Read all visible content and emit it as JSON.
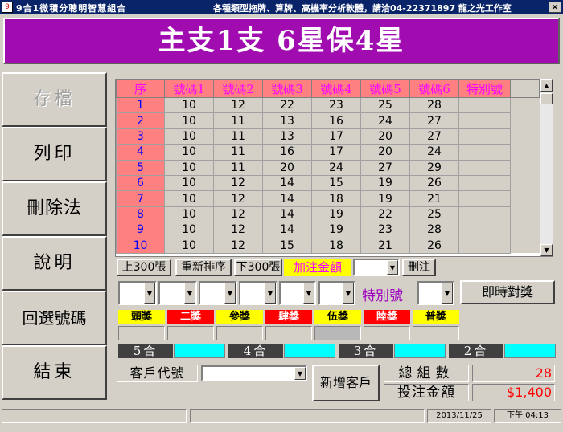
{
  "window": {
    "title": "9合1微積分聰明智慧組合",
    "subtitle": "各種類型拖牌、算牌、高機率分析軟體，請洽04-22371897 龍之光工作室",
    "close_glyph": "×"
  },
  "banner": {
    "text": "主支1支   6星保4星"
  },
  "sidebar": {
    "items": [
      {
        "label": "存檔",
        "enabled": false
      },
      {
        "label": "列印",
        "enabled": true
      },
      {
        "label": "刪除法",
        "enabled": true
      },
      {
        "label": "說明",
        "enabled": true
      },
      {
        "label": "回選號碼",
        "enabled": true
      },
      {
        "label": "結束",
        "enabled": true
      }
    ]
  },
  "grid": {
    "headers": [
      "序",
      "號碼1",
      "號碼2",
      "號碼3",
      "號碼4",
      "號碼5",
      "號碼6",
      "特別號"
    ],
    "rows": [
      [
        "1",
        "10",
        "12",
        "22",
        "23",
        "25",
        "28",
        ""
      ],
      [
        "2",
        "10",
        "11",
        "13",
        "16",
        "24",
        "27",
        ""
      ],
      [
        "3",
        "10",
        "11",
        "13",
        "17",
        "20",
        "27",
        ""
      ],
      [
        "4",
        "10",
        "11",
        "16",
        "17",
        "20",
        "24",
        ""
      ],
      [
        "5",
        "10",
        "11",
        "20",
        "24",
        "27",
        "29",
        ""
      ],
      [
        "6",
        "10",
        "12",
        "14",
        "15",
        "19",
        "26",
        ""
      ],
      [
        "7",
        "10",
        "12",
        "14",
        "18",
        "19",
        "21",
        ""
      ],
      [
        "8",
        "10",
        "12",
        "14",
        "19",
        "22",
        "25",
        ""
      ],
      [
        "9",
        "10",
        "12",
        "14",
        "19",
        "23",
        "28",
        ""
      ],
      [
        "10",
        "10",
        "12",
        "15",
        "18",
        "21",
        "26",
        ""
      ]
    ]
  },
  "toolbar": {
    "prev_label": "上300張",
    "resort_label": "重新排序",
    "next_label": "下300張",
    "add_amount_label": "加注金額",
    "delete_label": "刪注"
  },
  "numbers": {
    "special_label": "特別號",
    "instant_check_label": "即時對獎"
  },
  "prizes": [
    "頭獎",
    "二獎",
    "參獎",
    "肆獎",
    "伍獎",
    "陸獎",
    "普獎"
  ],
  "prize_colors": [
    "#ffff00",
    "#ff0000",
    "#ffff00",
    "#ff0000",
    "#ffff00",
    "#ff0000",
    "#ffff00"
  ],
  "matches": [
    "5合",
    "4合",
    "3合",
    "2合"
  ],
  "customer": {
    "code_label": "客戶代號",
    "add_label": "新增客戶"
  },
  "totals": {
    "groups_label": "總組數",
    "groups_value": "28",
    "amount_label": "投注金額",
    "amount_value": "$1,400",
    "value_color": "#ff0000"
  },
  "status": {
    "date": "2013/11/25",
    "time": "下午 04:13"
  }
}
